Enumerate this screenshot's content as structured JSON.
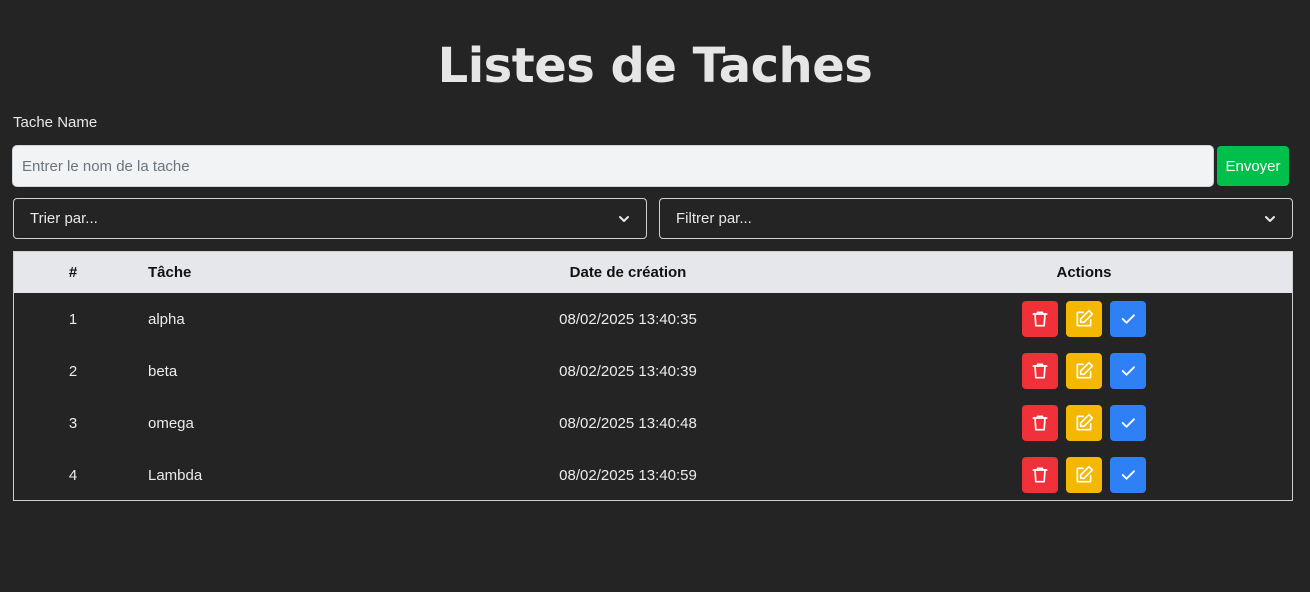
{
  "page": {
    "title": "Listes de Taches"
  },
  "form": {
    "label": "Tache Name",
    "input_value": "",
    "input_placeholder": "Entrer le nom de la tache",
    "submit_label": "Envoyer"
  },
  "sort": {
    "selected": "Trier par..."
  },
  "filter": {
    "selected": "Filtrer par..."
  },
  "table": {
    "headers": [
      "#",
      "Tâche",
      "Date de création",
      "Actions"
    ],
    "rows": [
      {
        "num": "1",
        "name": "alpha",
        "date": "08/02/2025 13:40:35"
      },
      {
        "num": "2",
        "name": "beta",
        "date": "08/02/2025 13:40:39"
      },
      {
        "num": "3",
        "name": "omega",
        "date": "08/02/2025 13:40:48"
      },
      {
        "num": "4",
        "name": "Lambda",
        "date": "08/02/2025 13:40:59"
      }
    ],
    "action_icons": [
      "trash-icon",
      "edit-icon",
      "check-icon"
    ]
  },
  "colors": {
    "background": "#242424",
    "submit": "#00c04b",
    "delete": "#f0313a",
    "edit": "#f5b800",
    "done": "#2f80f5"
  }
}
